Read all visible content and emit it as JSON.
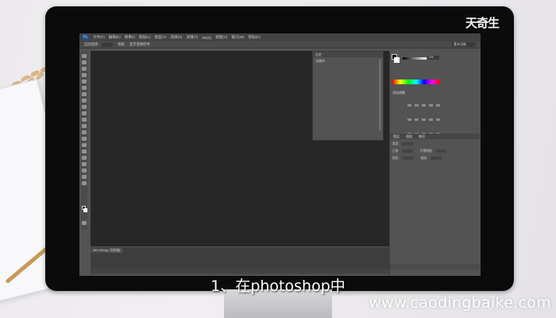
{
  "brand": {
    "logo_text": "天奇生"
  },
  "photoshop": {
    "app_icon": "Ps",
    "menus": [
      "文件(F)",
      "编辑(E)",
      "图像(I)",
      "图层(L)",
      "类型(Y)",
      "选择(S)",
      "滤镜(T)",
      "3D(D)",
      "视图(V)",
      "窗口(W)",
      "帮助(H)"
    ],
    "options": [
      "自动选择:",
      "图层",
      "显示变换控件"
    ],
    "workspace": "基本功能",
    "history_panel": {
      "title": "历史",
      "item": "无操作"
    },
    "color_panel": {
      "value": "100"
    },
    "adjustments_title": "添加调整",
    "layers_tabs": [
      "图层",
      "通道",
      "路径"
    ],
    "layer_rows": [
      "类型",
      "正常",
      "不透明度",
      "锁定:",
      "填充:"
    ],
    "timeline_tabs": [
      "Mini Bridge",
      "时间轴"
    ]
  },
  "subtitle": "1、在photoshop中",
  "watermark": "www.caodingbaike.com",
  "icons": [
    "ps-app-icon",
    "move-tool-icon",
    "marquee-tool-icon",
    "lasso-tool-icon",
    "brush-tool-icon",
    "pen-tool-icon",
    "text-tool-icon",
    "hand-tool-icon",
    "zoom-tool-icon"
  ]
}
